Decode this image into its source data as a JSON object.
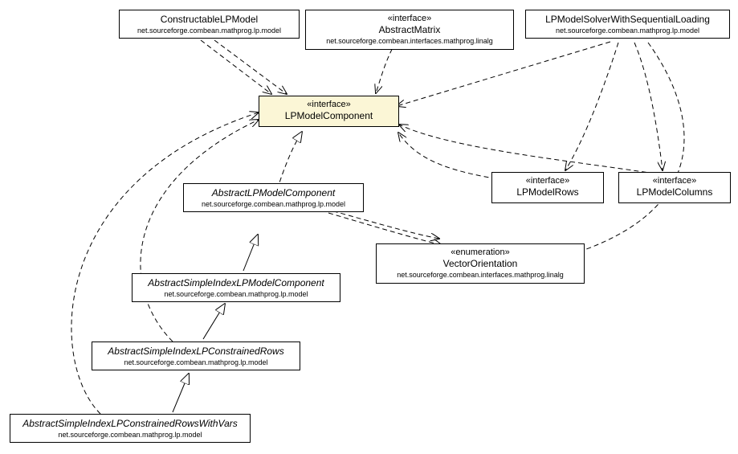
{
  "stereotypes": {
    "interface": "«interface»",
    "enumeration": "«enumeration»"
  },
  "packages": {
    "model": "net.sourceforge.combean.mathprog.lp.model",
    "linalg": "net.sourceforge.combean.interfaces.mathprog.linalg"
  },
  "nodes": {
    "constructable": "ConstructableLPModel",
    "abstractMatrix": "AbstractMatrix",
    "solver": "LPModelSolverWithSequentialLoading",
    "component": "LPModelComponent",
    "abstractComponent": "AbstractLPModelComponent",
    "modelRows": "LPModelRows",
    "modelColumns": "LPModelColumns",
    "vectorOrientation": "VectorOrientation",
    "simpleIndex": "AbstractSimpleIndexLPModelComponent",
    "constrainedRows": "AbstractSimpleIndexLPConstrainedRows",
    "constrainedRowsVars": "AbstractSimpleIndexLPConstrainedRowsWithVars"
  }
}
